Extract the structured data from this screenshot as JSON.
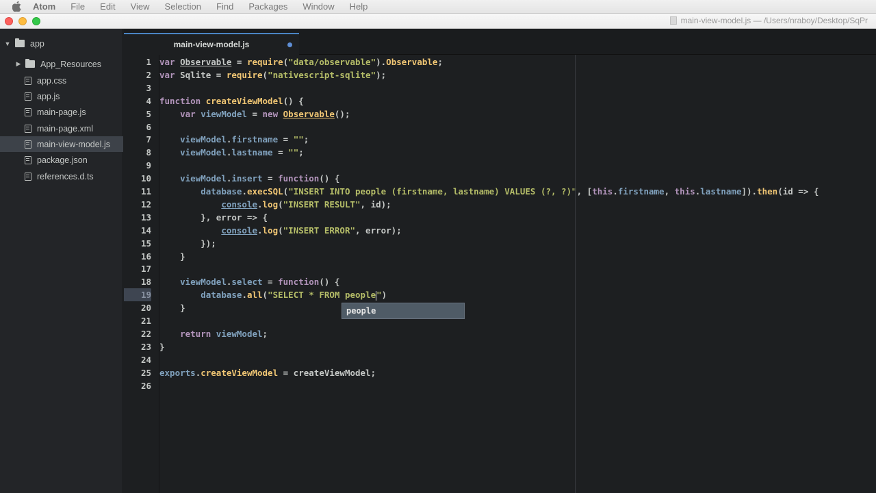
{
  "menubar": {
    "app_name": "Atom",
    "items": [
      "File",
      "Edit",
      "View",
      "Selection",
      "Find",
      "Packages",
      "Window",
      "Help"
    ]
  },
  "window": {
    "title": "main-view-model.js — /Users/nraboy/Desktop/SqPr"
  },
  "sidebar": {
    "root": "app",
    "items": [
      {
        "label": "App_Resources",
        "type": "folder"
      },
      {
        "label": "app.css",
        "type": "file"
      },
      {
        "label": "app.js",
        "type": "file"
      },
      {
        "label": "main-page.js",
        "type": "file"
      },
      {
        "label": "main-page.xml",
        "type": "file"
      },
      {
        "label": "main-view-model.js",
        "type": "file",
        "selected": true
      },
      {
        "label": "package.json",
        "type": "file"
      },
      {
        "label": "references.d.ts",
        "type": "file"
      }
    ]
  },
  "tab": {
    "label": "main-view-model.js"
  },
  "editor": {
    "current_line": 19,
    "lines": [
      "var Observable = require(\"data/observable\").Observable;",
      "var Sqlite = require(\"nativescript-sqlite\");",
      "",
      "function createViewModel() {",
      "    var viewModel = new Observable();",
      "",
      "    viewModel.firstname = \"\";",
      "    viewModel.lastname = \"\";",
      "",
      "    viewModel.insert = function() {",
      "        database.execSQL(\"INSERT INTO people (firstname, lastname) VALUES (?, ?)\", [this.firstname, this.lastname]).then(id => {",
      "            console.log(\"INSERT RESULT\", id);",
      "        }, error => {",
      "            console.log(\"INSERT ERROR\", error);",
      "        });",
      "    }",
      "",
      "    viewModel.select = function() {",
      "        database.all(\"SELECT * FROM people\")",
      "    }",
      "",
      "    return viewModel;",
      "}",
      "",
      "exports.createViewModel = createViewModel;",
      ""
    ]
  },
  "autocomplete": {
    "suggestion": "people"
  }
}
